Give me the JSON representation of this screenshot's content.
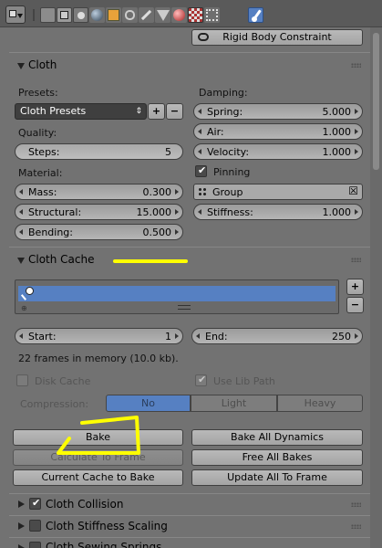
{
  "header": {
    "tabs": [
      "render-tab",
      "render-layers-tab",
      "scene-tab",
      "world-tab",
      "object-tab",
      "constraints-tab",
      "modifiers-tab",
      "data-tab",
      "material-tab",
      "texture-tab",
      "particles-tab",
      "physics-tab"
    ],
    "active_tab": "physics-tab"
  },
  "top_button": {
    "label": "Rigid Body Constraint",
    "icon": "link-icon"
  },
  "cloth": {
    "title": "Cloth",
    "presets_label": "Presets:",
    "presets_value": "Cloth Presets",
    "quality_label": "Quality:",
    "steps_label": "Steps:",
    "steps_value": "5",
    "material_label": "Material:",
    "mass_label": "Mass:",
    "mass_value": "0.300",
    "structural_label": "Structural:",
    "structural_value": "15.000",
    "bending_label": "Bending:",
    "bending_value": "0.500",
    "damping_label": "Damping:",
    "spring_label": "Spring:",
    "spring_value": "5.000",
    "air_label": "Air:",
    "air_value": "1.000",
    "velocity_label": "Velocity:",
    "velocity_value": "1.000",
    "pinning_label": "Pinning",
    "group_label": "Group",
    "stiffness_label": "Stiffness:",
    "stiffness_value": "1.000"
  },
  "cache": {
    "title": "Cloth Cache",
    "start_label": "Start:",
    "start_value": "1",
    "end_label": "End:",
    "end_value": "250",
    "info": "22 frames in memory (10.0 kb).",
    "disk_cache_label": "Disk Cache",
    "use_lib_path_label": "Use Lib Path",
    "compression_label": "Compression:",
    "compression_options": [
      "No",
      "Light",
      "Heavy"
    ],
    "compression_selected": "No",
    "bake_label": "Bake",
    "bake_all_label": "Bake All Dynamics",
    "calc_to_frame_label": "Calculate To Frame",
    "free_all_label": "Free All Bakes",
    "current_cache_label": "Current Cache to Bake",
    "update_all_label": "Update All To Frame"
  },
  "collapsed_panels": [
    {
      "label": "Cloth Collision",
      "checked": true
    },
    {
      "label": "Cloth Stiffness Scaling",
      "checked": false
    },
    {
      "label": "Cloth Sewing Springs",
      "checked": false
    }
  ],
  "colors": {
    "selection_blue": "#5680c2",
    "annotation_yellow": "#ffff00"
  }
}
